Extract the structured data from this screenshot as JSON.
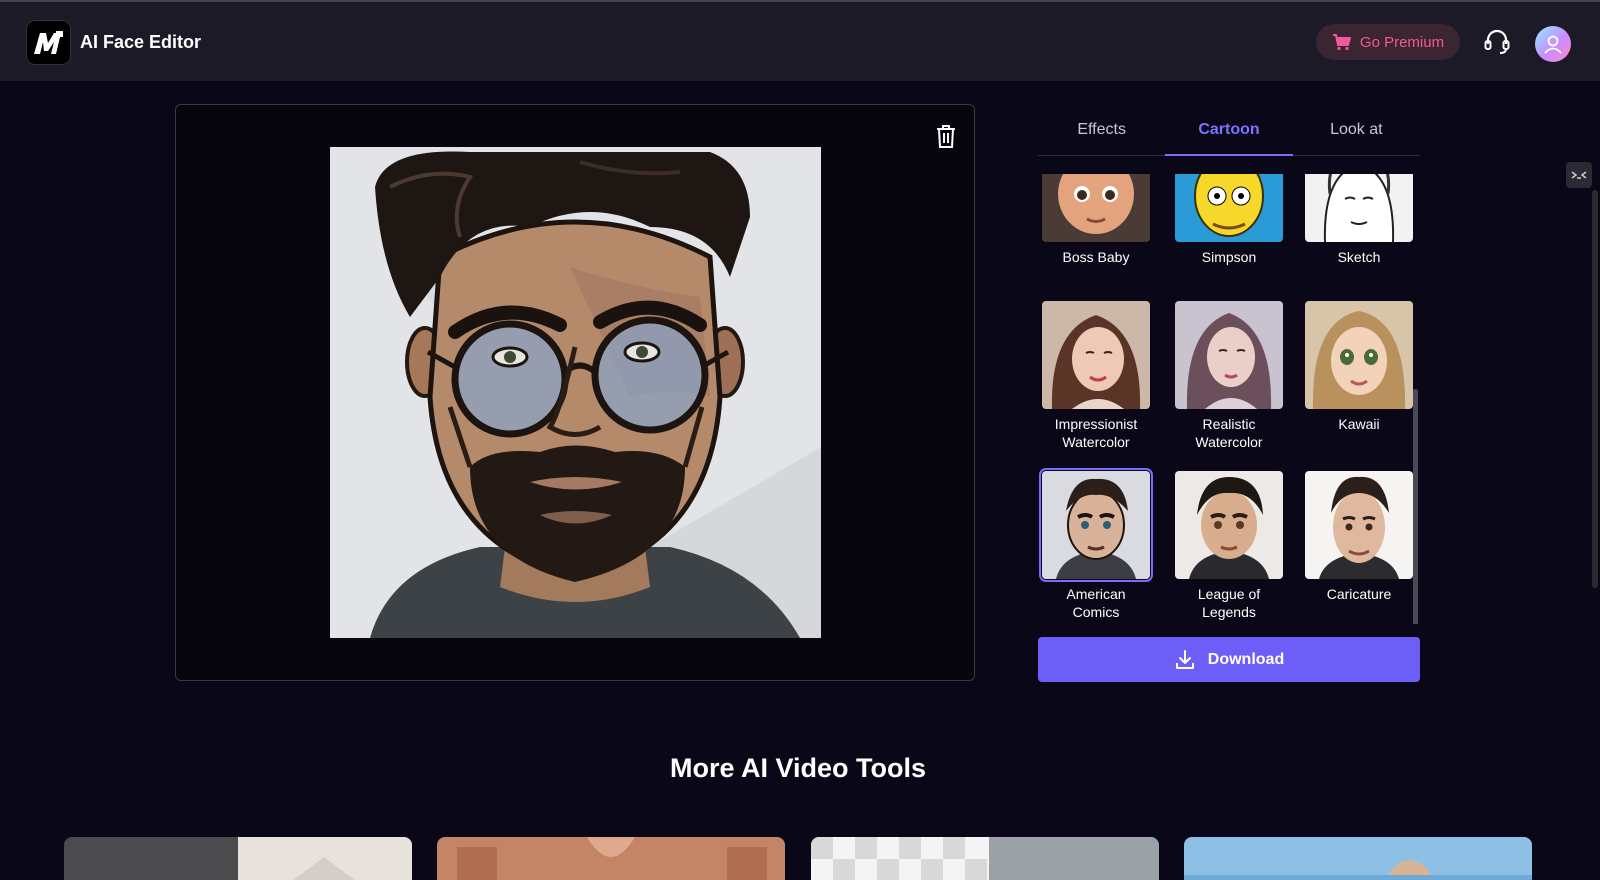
{
  "app": {
    "title": "AI Face Editor",
    "logo_text": "M"
  },
  "header": {
    "premium_label": "Go Premium"
  },
  "tabs": [
    {
      "label": "Effects",
      "active": false
    },
    {
      "label": "Cartoon",
      "active": true
    },
    {
      "label": "Look at",
      "active": false
    }
  ],
  "styles": [
    {
      "label": "Boss Baby"
    },
    {
      "label": "Simpson"
    },
    {
      "label": "Sketch"
    },
    {
      "label": "Impressionist Watercolor"
    },
    {
      "label": "Realistic Watercolor"
    },
    {
      "label": "Kawaii"
    },
    {
      "label": "American Comics",
      "selected": true
    },
    {
      "label": "League of Legends"
    },
    {
      "label": "Caricature"
    }
  ],
  "download_label": "Download",
  "more_tools": {
    "title": "More AI Video Tools"
  },
  "colors": {
    "accent": "#6e5ef8",
    "premium": "#f05a9a",
    "background": "#0a0818"
  },
  "icons": [
    "cart-icon",
    "headset-icon",
    "user-icon",
    "trash-icon",
    "download-icon"
  ]
}
